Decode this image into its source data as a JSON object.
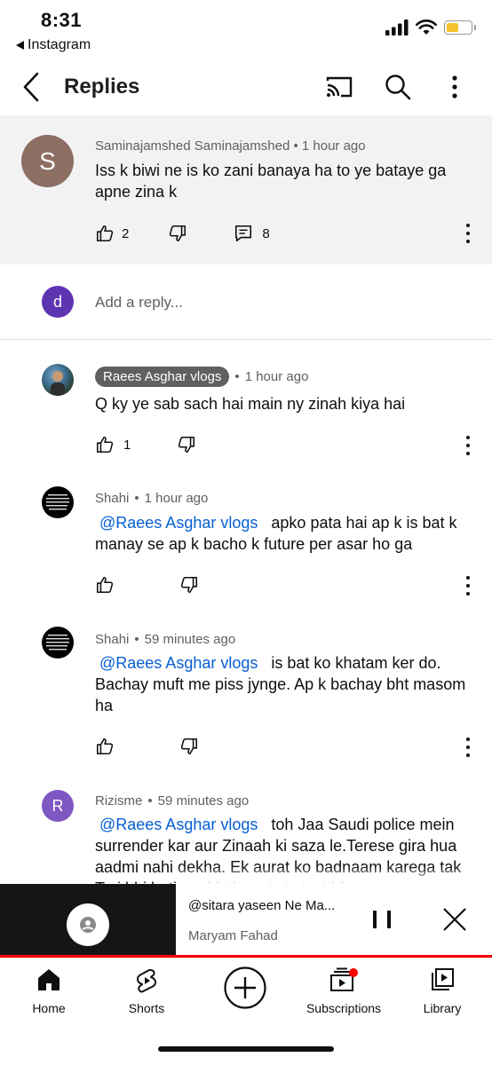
{
  "status_bar": {
    "time": "8:31",
    "back_app": "Instagram"
  },
  "header": {
    "title": "Replies"
  },
  "parent_comment": {
    "avatar_letter": "S",
    "author": "Saminajamshed Saminajamshed",
    "time": "1 hour ago",
    "text": "Iss k biwi ne is ko zani banaya ha to ye bataye ga apne zina k",
    "likes": "2",
    "replies": "8"
  },
  "add_reply": {
    "avatar_letter": "d",
    "placeholder": "Add a reply..."
  },
  "replies": [
    {
      "author": "Raees Asghar vlogs",
      "time": "1 hour ago",
      "text": "Q ky ye sab sach hai main ny zinah kiya hai",
      "likes": "1"
    },
    {
      "author": "Shahi",
      "time": "1 hour ago",
      "mention": "@Raees Asghar vlogs",
      "text": "apko pata hai ap k is bat k manay se ap k bacho k future per asar ho ga"
    },
    {
      "author": "Shahi",
      "time": "59 minutes ago",
      "mention": "@Raees Asghar vlogs",
      "text": "is bat ko khatam ker do. Bachay muft me piss jynge. Ap k bachay bht masom ha"
    },
    {
      "avatar_letter": "R",
      "author": "Rizisme",
      "time": "59 minutes ago",
      "mention": "@Raees Asghar vlogs",
      "text": "toh Jaa Saudi police mein surrender kar aur Zinaah ki saza le.Terese gira hua aadmi nahi dekha. Ek aurat ko badnaam karega tak Teri bhi betiyan bhi hongi zindagi bhar"
    }
  ],
  "mini_player": {
    "title": "@sitara yaseen Ne Ma...",
    "channel": "Maryam Fahad"
  },
  "bottom_nav": {
    "home": "Home",
    "shorts": "Shorts",
    "subscriptions": "Subscriptions",
    "library": "Library"
  },
  "colors": {
    "accent_red": "#ff0000",
    "link_blue": "#065fd4",
    "parent_bg": "#f2f2f2"
  }
}
